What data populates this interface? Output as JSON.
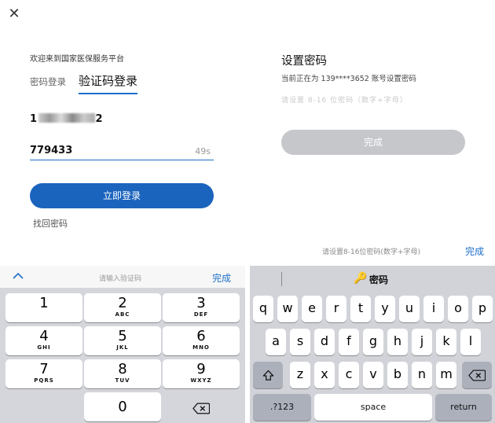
{
  "login": {
    "close_icon": "close-icon",
    "welcome": "欢迎来到国家医保服务平台",
    "tab_password": "密码登录",
    "tab_code": "验证码登录",
    "phone_prefix": "1",
    "phone_suffix": "2",
    "code_value": "779433",
    "code_timer": "49s",
    "login_button": "立即登录",
    "forgot_password": "找回密码"
  },
  "set_password": {
    "title": "设置密码",
    "subtitle": "当前正在为 139****3652 账号设置密码",
    "input_placeholder": "请设置 8-16 位密码（数字+字母）",
    "done_button": "完成",
    "hint_text": "请设置8-16位密码(数字+字母)",
    "hint_done": "完成"
  },
  "numeric_keyboard": {
    "placeholder": "请输入验证码",
    "done": "完成",
    "keys": [
      {
        "digit": "1",
        "letters": ""
      },
      {
        "digit": "2",
        "letters": "ABC"
      },
      {
        "digit": "3",
        "letters": "DEF"
      },
      {
        "digit": "4",
        "letters": "GHI"
      },
      {
        "digit": "5",
        "letters": "JKL"
      },
      {
        "digit": "6",
        "letters": "MNO"
      },
      {
        "digit": "7",
        "letters": "PQRS"
      },
      {
        "digit": "8",
        "letters": "TUV"
      },
      {
        "digit": "9",
        "letters": "WXYZ"
      },
      {
        "digit": "0",
        "letters": ""
      }
    ]
  },
  "qwerty_keyboard": {
    "header_label": "密码",
    "row1": [
      "q",
      "w",
      "e",
      "r",
      "t",
      "y",
      "u",
      "i",
      "o",
      "p"
    ],
    "row2": [
      "a",
      "s",
      "d",
      "f",
      "g",
      "h",
      "j",
      "k",
      "l"
    ],
    "row3": [
      "z",
      "x",
      "c",
      "v",
      "b",
      "n",
      "m"
    ],
    "numbers_key": ".?123",
    "space_key": "space",
    "return_key": "return"
  },
  "colors": {
    "accent": "#1e6fc8",
    "login_button": "#1b64be",
    "disabled_button": "#c5c7cb",
    "keyboard_bg": "#d1d3d9"
  }
}
